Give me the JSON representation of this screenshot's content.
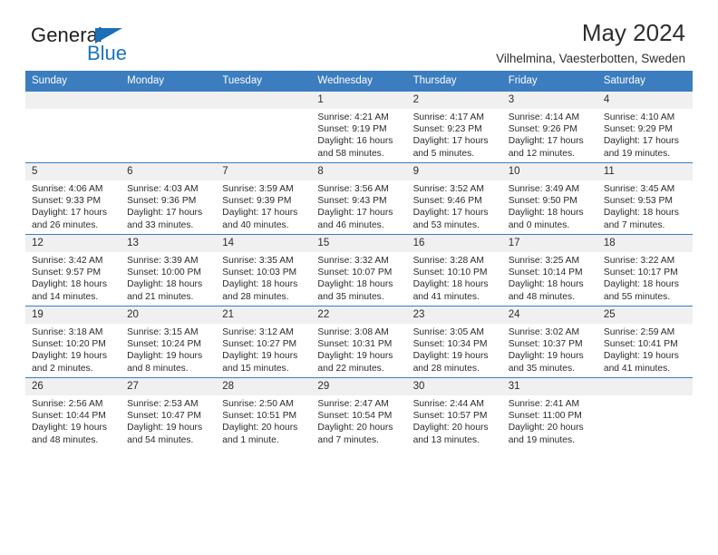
{
  "brand": {
    "name_part1": "General",
    "name_part2": "Blue",
    "accent_color": "#1b75bb",
    "header_color": "#3b7dbf"
  },
  "header": {
    "title": "May 2024",
    "subtitle": "Vilhelmina, Vaesterbotten, Sweden"
  },
  "weekday_headers": [
    "Sunday",
    "Monday",
    "Tuesday",
    "Wednesday",
    "Thursday",
    "Friday",
    "Saturday"
  ],
  "labels": {
    "sunrise": "Sunrise:",
    "sunset": "Sunset:",
    "daylight": "Daylight:"
  },
  "weeks": [
    [
      {
        "day": "",
        "sunrise": "",
        "sunset": "",
        "daylight": "",
        "empty": true
      },
      {
        "day": "",
        "sunrise": "",
        "sunset": "",
        "daylight": "",
        "empty": true
      },
      {
        "day": "",
        "sunrise": "",
        "sunset": "",
        "daylight": "",
        "empty": true
      },
      {
        "day": "1",
        "sunrise": "Sunrise: 4:21 AM",
        "sunset": "Sunset: 9:19 PM",
        "daylight": "Daylight: 16 hours and 58 minutes."
      },
      {
        "day": "2",
        "sunrise": "Sunrise: 4:17 AM",
        "sunset": "Sunset: 9:23 PM",
        "daylight": "Daylight: 17 hours and 5 minutes."
      },
      {
        "day": "3",
        "sunrise": "Sunrise: 4:14 AM",
        "sunset": "Sunset: 9:26 PM",
        "daylight": "Daylight: 17 hours and 12 minutes."
      },
      {
        "day": "4",
        "sunrise": "Sunrise: 4:10 AM",
        "sunset": "Sunset: 9:29 PM",
        "daylight": "Daylight: 17 hours and 19 minutes."
      }
    ],
    [
      {
        "day": "5",
        "sunrise": "Sunrise: 4:06 AM",
        "sunset": "Sunset: 9:33 PM",
        "daylight": "Daylight: 17 hours and 26 minutes."
      },
      {
        "day": "6",
        "sunrise": "Sunrise: 4:03 AM",
        "sunset": "Sunset: 9:36 PM",
        "daylight": "Daylight: 17 hours and 33 minutes."
      },
      {
        "day": "7",
        "sunrise": "Sunrise: 3:59 AM",
        "sunset": "Sunset: 9:39 PM",
        "daylight": "Daylight: 17 hours and 40 minutes."
      },
      {
        "day": "8",
        "sunrise": "Sunrise: 3:56 AM",
        "sunset": "Sunset: 9:43 PM",
        "daylight": "Daylight: 17 hours and 46 minutes."
      },
      {
        "day": "9",
        "sunrise": "Sunrise: 3:52 AM",
        "sunset": "Sunset: 9:46 PM",
        "daylight": "Daylight: 17 hours and 53 minutes."
      },
      {
        "day": "10",
        "sunrise": "Sunrise: 3:49 AM",
        "sunset": "Sunset: 9:50 PM",
        "daylight": "Daylight: 18 hours and 0 minutes."
      },
      {
        "day": "11",
        "sunrise": "Sunrise: 3:45 AM",
        "sunset": "Sunset: 9:53 PM",
        "daylight": "Daylight: 18 hours and 7 minutes."
      }
    ],
    [
      {
        "day": "12",
        "sunrise": "Sunrise: 3:42 AM",
        "sunset": "Sunset: 9:57 PM",
        "daylight": "Daylight: 18 hours and 14 minutes."
      },
      {
        "day": "13",
        "sunrise": "Sunrise: 3:39 AM",
        "sunset": "Sunset: 10:00 PM",
        "daylight": "Daylight: 18 hours and 21 minutes."
      },
      {
        "day": "14",
        "sunrise": "Sunrise: 3:35 AM",
        "sunset": "Sunset: 10:03 PM",
        "daylight": "Daylight: 18 hours and 28 minutes."
      },
      {
        "day": "15",
        "sunrise": "Sunrise: 3:32 AM",
        "sunset": "Sunset: 10:07 PM",
        "daylight": "Daylight: 18 hours and 35 minutes."
      },
      {
        "day": "16",
        "sunrise": "Sunrise: 3:28 AM",
        "sunset": "Sunset: 10:10 PM",
        "daylight": "Daylight: 18 hours and 41 minutes."
      },
      {
        "day": "17",
        "sunrise": "Sunrise: 3:25 AM",
        "sunset": "Sunset: 10:14 PM",
        "daylight": "Daylight: 18 hours and 48 minutes."
      },
      {
        "day": "18",
        "sunrise": "Sunrise: 3:22 AM",
        "sunset": "Sunset: 10:17 PM",
        "daylight": "Daylight: 18 hours and 55 minutes."
      }
    ],
    [
      {
        "day": "19",
        "sunrise": "Sunrise: 3:18 AM",
        "sunset": "Sunset: 10:20 PM",
        "daylight": "Daylight: 19 hours and 2 minutes."
      },
      {
        "day": "20",
        "sunrise": "Sunrise: 3:15 AM",
        "sunset": "Sunset: 10:24 PM",
        "daylight": "Daylight: 19 hours and 8 minutes."
      },
      {
        "day": "21",
        "sunrise": "Sunrise: 3:12 AM",
        "sunset": "Sunset: 10:27 PM",
        "daylight": "Daylight: 19 hours and 15 minutes."
      },
      {
        "day": "22",
        "sunrise": "Sunrise: 3:08 AM",
        "sunset": "Sunset: 10:31 PM",
        "daylight": "Daylight: 19 hours and 22 minutes."
      },
      {
        "day": "23",
        "sunrise": "Sunrise: 3:05 AM",
        "sunset": "Sunset: 10:34 PM",
        "daylight": "Daylight: 19 hours and 28 minutes."
      },
      {
        "day": "24",
        "sunrise": "Sunrise: 3:02 AM",
        "sunset": "Sunset: 10:37 PM",
        "daylight": "Daylight: 19 hours and 35 minutes."
      },
      {
        "day": "25",
        "sunrise": "Sunrise: 2:59 AM",
        "sunset": "Sunset: 10:41 PM",
        "daylight": "Daylight: 19 hours and 41 minutes."
      }
    ],
    [
      {
        "day": "26",
        "sunrise": "Sunrise: 2:56 AM",
        "sunset": "Sunset: 10:44 PM",
        "daylight": "Daylight: 19 hours and 48 minutes."
      },
      {
        "day": "27",
        "sunrise": "Sunrise: 2:53 AM",
        "sunset": "Sunset: 10:47 PM",
        "daylight": "Daylight: 19 hours and 54 minutes."
      },
      {
        "day": "28",
        "sunrise": "Sunrise: 2:50 AM",
        "sunset": "Sunset: 10:51 PM",
        "daylight": "Daylight: 20 hours and 1 minute."
      },
      {
        "day": "29",
        "sunrise": "Sunrise: 2:47 AM",
        "sunset": "Sunset: 10:54 PM",
        "daylight": "Daylight: 20 hours and 7 minutes."
      },
      {
        "day": "30",
        "sunrise": "Sunrise: 2:44 AM",
        "sunset": "Sunset: 10:57 PM",
        "daylight": "Daylight: 20 hours and 13 minutes."
      },
      {
        "day": "31",
        "sunrise": "Sunrise: 2:41 AM",
        "sunset": "Sunset: 11:00 PM",
        "daylight": "Daylight: 20 hours and 19 minutes."
      },
      {
        "day": "",
        "sunrise": "",
        "sunset": "",
        "daylight": "",
        "empty": true
      }
    ]
  ]
}
